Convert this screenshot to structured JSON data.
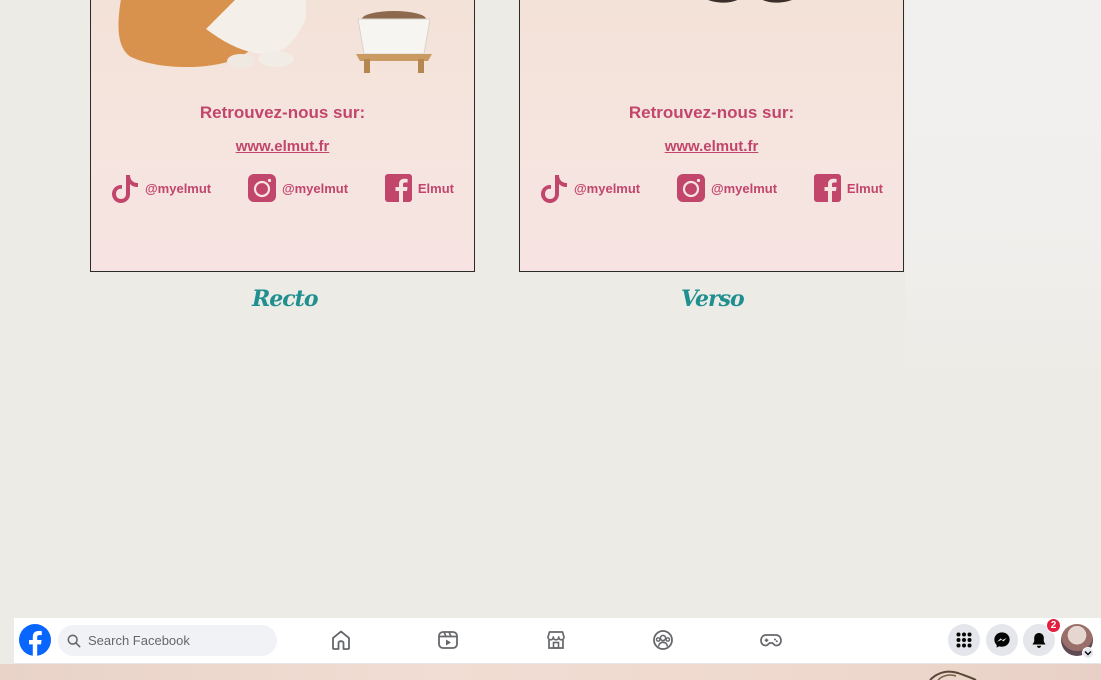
{
  "recto": {
    "headline": "Retrouvez-nous sur:",
    "website": "www.elmut.fr",
    "socials": [
      {
        "icon": "tiktok-icon",
        "label": "@myelmut"
      },
      {
        "icon": "instagram-icon",
        "label": "@myelmut"
      },
      {
        "icon": "facebook-icon",
        "label": "Elmut"
      }
    ],
    "caption": "Recto"
  },
  "verso": {
    "headline": "Retrouvez-nous sur:",
    "website": "www.elmut.fr",
    "socials": [
      {
        "icon": "tiktok-icon",
        "label": "@myelmut"
      },
      {
        "icon": "instagram-icon",
        "label": "@myelmut"
      },
      {
        "icon": "facebook-icon",
        "label": "Elmut"
      }
    ],
    "caption": "Verso"
  },
  "facebook_bar": {
    "search_placeholder": "Search Facebook",
    "nav_icons": [
      "home-icon",
      "video-icon",
      "marketplace-icon",
      "groups-icon",
      "gaming-icon"
    ],
    "notifications_count": "2",
    "accent_color": "#0866ff",
    "badge_color": "#e41e3f"
  },
  "colors": {
    "card_text": "#c2456b",
    "caption": "#1f8f90"
  }
}
